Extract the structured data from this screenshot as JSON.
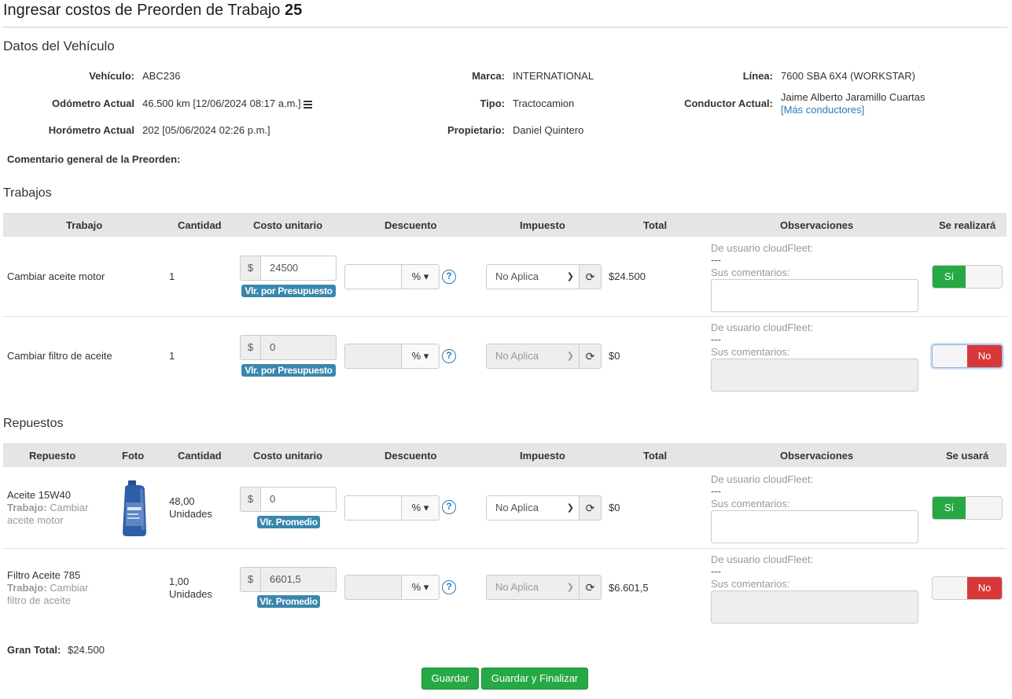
{
  "page": {
    "title_text": "Ingresar costos de Preorden de Trabajo",
    "title_number": "25"
  },
  "vehicle_section": {
    "title": "Datos del Vehículo",
    "vehiculo_label": "Vehículo:",
    "vehiculo": "ABC236",
    "odometro_label": "Odómetro Actual",
    "odometro": "46.500 km [12/06/2024 08:17 a.m.]",
    "horometro_label": "Horómetro Actual",
    "horometro": "202 [05/06/2024 02:26 p.m.]",
    "marca_label": "Marca:",
    "marca": "INTERNATIONAL",
    "tipo_label": "Tipo:",
    "tipo": "Tractocamion",
    "propietario_label": "Propietario:",
    "propietario": "Daniel Quintero",
    "linea_label": "Línea:",
    "linea": "7600 SBA 6X4 (WORKSTAR)",
    "conductor_label": "Conductor Actual:",
    "conductor": "Jaime Alberto Jaramillo Cuartas",
    "mas_conductores": "[Más conductores]",
    "comentario_label": "Comentario general de la Preorden:"
  },
  "trabajos": {
    "title": "Trabajos",
    "headers": {
      "trabajo": "Trabajo",
      "cantidad": "Cantidad",
      "costo": "Costo unitario",
      "descuento": "Descuento",
      "impuesto": "Impuesto",
      "total": "Total",
      "observaciones": "Observaciones",
      "realizara": "Se realizará"
    },
    "rows": [
      {
        "name": "Cambiar aceite motor",
        "cantidad": "1",
        "currency": "$",
        "costo": "24500",
        "badge": "Vlr. por Presupuesto",
        "pct": "% ▾",
        "tax": "No Aplica",
        "total": "$24.500",
        "obs_user": "De usuario cloudFleet:",
        "obs_dash": "---",
        "obs_label": "Sus comentarios:",
        "toggle": "Sí"
      },
      {
        "name": "Cambiar filtro de aceite",
        "cantidad": "1",
        "currency": "$",
        "costo": "0",
        "badge": "Vlr. por Presupuesto",
        "pct": "% ▾",
        "tax": "No Aplica",
        "total": "$0",
        "obs_user": "De usuario cloudFleet:",
        "obs_dash": "---",
        "obs_label": "Sus comentarios:",
        "toggle": "No"
      }
    ]
  },
  "repuestos": {
    "title": "Repuestos",
    "headers": {
      "repuesto": "Repuesto",
      "foto": "Foto",
      "cantidad": "Cantidad",
      "costo": "Costo unitario",
      "descuento": "Descuento",
      "impuesto": "Impuesto",
      "total": "Total",
      "observaciones": "Observaciones",
      "usara": "Se usará"
    },
    "rows": [
      {
        "name": "Aceite 15W40",
        "trabajo_label": "Trabajo:",
        "trabajo_l1": "Cambiar",
        "trabajo_l2": "aceite motor",
        "cant_l1": "48,00",
        "cant_l2": "Unidades",
        "currency": "$",
        "costo": "0",
        "badge": "Vlr. Promedio",
        "pct": "% ▾",
        "tax": "No Aplica",
        "total": "$0",
        "obs_user": "De usuario cloudFleet:",
        "obs_dash": "---",
        "obs_label": "Sus comentarios:",
        "toggle": "Sí"
      },
      {
        "name": "Filtro Aceite 785",
        "trabajo_label": "Trabajo:",
        "trabajo_l1": "Cambiar",
        "trabajo_l2": "filtro de aceite",
        "cant_l1": "1,00",
        "cant_l2": "Unidades",
        "currency": "$",
        "costo": "6601,5",
        "badge": "Vlr. Promedio",
        "pct": "% ▾",
        "tax": "No Aplica",
        "total": "$6.601,5",
        "obs_user": "De usuario cloudFleet:",
        "obs_dash": "---",
        "obs_label": "Sus comentarios:",
        "toggle": "No"
      }
    ]
  },
  "footer": {
    "gran_total_label": "Gran Total:",
    "gran_total": "$24.500",
    "guardar": "Guardar",
    "guardar_finalizar": "Guardar y Finalizar"
  },
  "icons": {
    "list": "list-icon",
    "help": "question-circle-icon",
    "refresh": "refresh-icon",
    "chevron": "chevron-down-icon"
  },
  "colors": {
    "success": "#26a844",
    "danger": "#d9383a",
    "info_badge": "#3a87ad",
    "link": "#2a7ab8",
    "header_bg": "#e5e5e5"
  }
}
